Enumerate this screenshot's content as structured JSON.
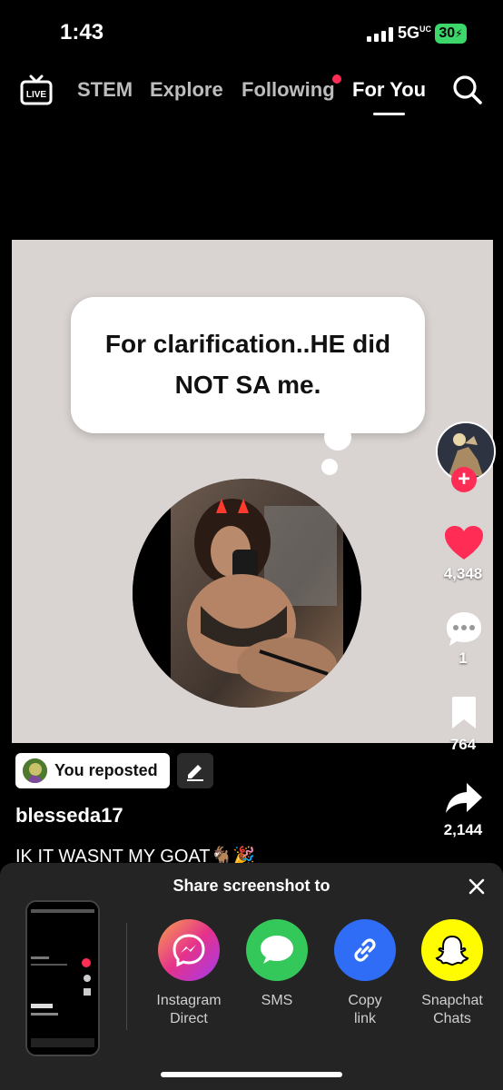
{
  "status_bar": {
    "time": "1:43",
    "network": "5G",
    "network_sup": "UC",
    "battery": "30"
  },
  "nav": {
    "live_label": "LIVE",
    "tabs": [
      {
        "label": "STEM"
      },
      {
        "label": "Explore"
      },
      {
        "label": "Following",
        "has_dot": true
      },
      {
        "label": "For You",
        "active": true
      }
    ]
  },
  "video": {
    "bubble_text": "For clarification..HE did NOT SA me."
  },
  "rail": {
    "likes": "4,348",
    "comments": "1",
    "bookmarks": "764",
    "shares": "2,144"
  },
  "caption_area": {
    "repost_label": "You reposted",
    "username": "blesseda17",
    "caption": "IK IT WASNT MY GOAT🐐🎉"
  },
  "share_sheet": {
    "title": "Share screenshot to",
    "targets": [
      {
        "label": "Instagram Direct",
        "icon": "messenger-icon",
        "color": "#c13584"
      },
      {
        "label": "SMS",
        "icon": "chat-bubble-icon",
        "color": "#34c759"
      },
      {
        "label": "Copy link",
        "icon": "link-icon",
        "color": "#2f6df6"
      },
      {
        "label": "Snapchat Chats",
        "icon": "ghost-icon",
        "color": "#fffc00"
      }
    ]
  },
  "colors": {
    "accent_red": "#ff2c55",
    "background": "#000000",
    "sheet": "#242424"
  }
}
